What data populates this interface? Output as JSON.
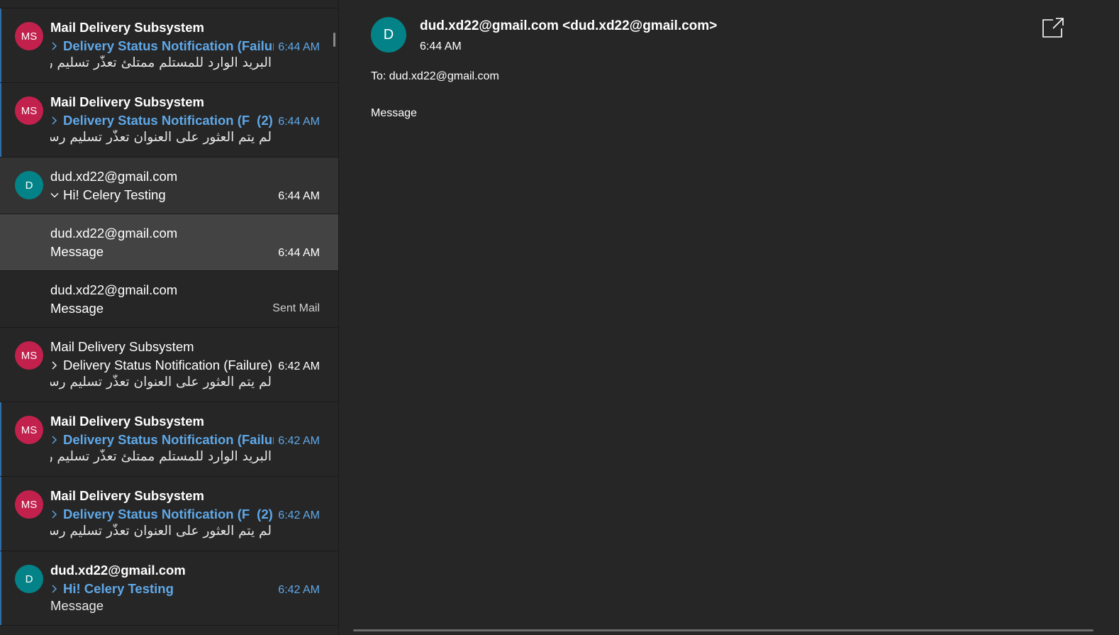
{
  "list": {
    "items": [
      {
        "sender": "Mail Delivery Subsystem",
        "initials": "MS",
        "subject": "Delivery Status Notification (Failure)",
        "count": "",
        "time": "6:44 AM",
        "preview": "البريد الوارد للمستلم ممتلئ تعذّر تسليم رسالتك",
        "bold": true
      },
      {
        "sender": "Mail Delivery Subsystem",
        "initials": "MS",
        "subject": "Delivery Status Notification (F",
        "count": "(2)",
        "time": "6:44 AM",
        "preview": "لم يتم العثور على العنوان تعذّر تسليم رسالتك",
        "bold": true
      },
      {
        "sender": "dud.xd22@gmail.com",
        "initials": "D",
        "subject": "Hi! Celery Testing",
        "time": "6:44 AM"
      },
      {
        "sender": "dud.xd22@gmail.com",
        "subject": "Message",
        "time": "6:44 AM"
      },
      {
        "sender": "dud.xd22@gmail.com",
        "subject": "Message",
        "folder": "Sent Mail"
      },
      {
        "sender": "Mail Delivery Subsystem",
        "initials": "MS",
        "subject": "Delivery Status Notification (Failure)",
        "count": "",
        "time": "6:42 AM",
        "preview": "لم يتم العثور على العنوان تعذّر تسليم رسالتك",
        "bold": false
      },
      {
        "sender": "Mail Delivery Subsystem",
        "initials": "MS",
        "subject": "Delivery Status Notification (Failure)",
        "count": "",
        "time": "6:42 AM",
        "preview": "البريد الوارد للمستلم ممتلئ تعذّر تسليم رسالتك",
        "bold": true
      },
      {
        "sender": "Mail Delivery Subsystem",
        "initials": "MS",
        "subject": "Delivery Status Notification (F",
        "count": "(2)",
        "time": "6:42 AM",
        "preview": "لم يتم العثور على العنوان تعذّر تسليم رسالتك",
        "bold": true
      },
      {
        "sender": "dud.xd22@gmail.com",
        "initials": "D",
        "subject": "Hi! Celery Testing",
        "count": "",
        "time": "6:42 AM",
        "preview": "Message",
        "bold": true
      }
    ]
  },
  "reader": {
    "avatar_initial": "D",
    "from": "dud.xd22@gmail.com <dud.xd22@gmail.com>",
    "time": "6:44 AM",
    "to": "To: dud.xd22@gmail.com",
    "body": "Message"
  },
  "colors": {
    "background": "#262626",
    "accent_blue": "#5fa8e8",
    "avatar_ms": "#c2214d",
    "avatar_d": "#038387",
    "selected_thread": "#333333",
    "selected_message": "#434343"
  },
  "icons": {
    "expand": "chevron-right-icon",
    "collapse": "chevron-down-icon",
    "popout": "open-in-new-window-icon"
  }
}
